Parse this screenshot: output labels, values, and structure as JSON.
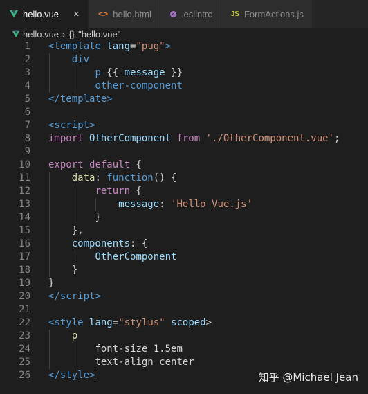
{
  "tabs": [
    {
      "label": "hello.vue",
      "icon": "vue-icon",
      "active": true,
      "close": "×"
    },
    {
      "label": "hello.html",
      "icon": "html-icon",
      "active": false
    },
    {
      "label": ".eslintrc",
      "icon": "eslintrc-icon",
      "active": false
    },
    {
      "label": "FormActions.js",
      "icon": "js-icon",
      "active": false
    }
  ],
  "icons": {
    "html": "<>",
    "js": "JS"
  },
  "breadcrumb": {
    "file": "hello.vue",
    "separator": "›",
    "symbol_icon": "{}",
    "symbol": "\"hello.vue\""
  },
  "colors": {
    "tag": "#569cd6",
    "attr": "#9cdcfe",
    "string": "#ce9178",
    "keyword": "#c586c0",
    "plain": "#d4d4d4",
    "pug": "#4ec9b0",
    "function": "#dcdcaa",
    "property": "#9cdcfe",
    "storage": "#569cd6",
    "stylus_prop": "#9cdcfe"
  },
  "lines": [
    {
      "n": "1",
      "indent": 0,
      "tokens": [
        [
          "<",
          "tag"
        ],
        [
          "template",
          "tag"
        ],
        [
          " lang",
          "attr"
        ],
        [
          "=",
          "plain"
        ],
        [
          "\"pug\"",
          "string"
        ],
        [
          ">",
          "tag"
        ]
      ]
    },
    {
      "n": "2",
      "indent": 1,
      "tokens": [
        [
          "div",
          "tag"
        ]
      ]
    },
    {
      "n": "3",
      "indent": 2,
      "tokens": [
        [
          "p",
          "tag"
        ],
        [
          " {{ ",
          "plain"
        ],
        [
          "message",
          "attr"
        ],
        [
          " }}",
          "plain"
        ]
      ]
    },
    {
      "n": "4",
      "indent": 2,
      "tokens": [
        [
          "other-component",
          "tag"
        ]
      ]
    },
    {
      "n": "5",
      "indent": 0,
      "tokens": [
        [
          "</",
          "tag"
        ],
        [
          "template",
          "tag"
        ],
        [
          ">",
          "tag"
        ]
      ]
    },
    {
      "n": "6",
      "indent": 0,
      "tokens": []
    },
    {
      "n": "7",
      "indent": 0,
      "tokens": [
        [
          "<",
          "tag"
        ],
        [
          "script",
          "tag"
        ],
        [
          ">",
          "tag"
        ]
      ]
    },
    {
      "n": "8",
      "indent": 0,
      "tokens": [
        [
          "import",
          "keyword"
        ],
        [
          " OtherComponent ",
          "attr"
        ],
        [
          "from",
          "keyword"
        ],
        [
          " ",
          "plain"
        ],
        [
          "'./OtherComponent.vue'",
          "string"
        ],
        [
          ";",
          "plain"
        ]
      ]
    },
    {
      "n": "9",
      "indent": 0,
      "tokens": []
    },
    {
      "n": "10",
      "indent": 0,
      "tokens": [
        [
          "export",
          "keyword"
        ],
        [
          " ",
          "plain"
        ],
        [
          "default",
          "keyword"
        ],
        [
          " {",
          "plain"
        ]
      ]
    },
    {
      "n": "11",
      "indent": 1,
      "tokens": [
        [
          "data",
          "function"
        ],
        [
          ": ",
          "plain"
        ],
        [
          "function",
          "storage"
        ],
        [
          "() {",
          "plain"
        ]
      ]
    },
    {
      "n": "12",
      "indent": 2,
      "tokens": [
        [
          "return",
          "keyword"
        ],
        [
          " {",
          "plain"
        ]
      ]
    },
    {
      "n": "13",
      "indent": 3,
      "tokens": [
        [
          "message",
          "property"
        ],
        [
          ": ",
          "plain"
        ],
        [
          "'Hello Vue.js'",
          "string"
        ]
      ]
    },
    {
      "n": "14",
      "indent": 2,
      "tokens": [
        [
          "}",
          "plain"
        ]
      ]
    },
    {
      "n": "15",
      "indent": 1,
      "tokens": [
        [
          "},",
          "plain"
        ]
      ]
    },
    {
      "n": "16",
      "indent": 1,
      "tokens": [
        [
          "components",
          "property"
        ],
        [
          ": {",
          "plain"
        ]
      ]
    },
    {
      "n": "17",
      "indent": 2,
      "tokens": [
        [
          "OtherComponent",
          "property"
        ]
      ]
    },
    {
      "n": "18",
      "indent": 1,
      "tokens": [
        [
          "}",
          "plain"
        ]
      ]
    },
    {
      "n": "19",
      "indent": 0,
      "tokens": [
        [
          "}",
          "plain"
        ]
      ]
    },
    {
      "n": "20",
      "indent": 0,
      "tokens": [
        [
          "</",
          "tag"
        ],
        [
          "script",
          "tag"
        ],
        [
          ">",
          "tag"
        ]
      ]
    },
    {
      "n": "21",
      "indent": 0,
      "tokens": []
    },
    {
      "n": "22",
      "indent": 0,
      "tokens": [
        [
          "<",
          "tag"
        ],
        [
          "style",
          "tag"
        ],
        [
          " lang",
          "attr"
        ],
        [
          "=",
          "plain"
        ],
        [
          "\"stylus\"",
          "string"
        ],
        [
          " scoped",
          "attr"
        ],
        [
          ">",
          "plain"
        ]
      ]
    },
    {
      "n": "23",
      "indent": 1,
      "tokens": [
        [
          "p",
          "function"
        ]
      ]
    },
    {
      "n": "24",
      "indent": 2,
      "tokens": [
        [
          "font-size",
          "plain"
        ],
        [
          " 1.5em",
          "plain"
        ]
      ]
    },
    {
      "n": "25",
      "indent": 2,
      "tokens": [
        [
          "text-align",
          "plain"
        ],
        [
          " center",
          "plain"
        ]
      ]
    },
    {
      "n": "26",
      "indent": 0,
      "tokens": [
        [
          "</",
          "tag"
        ],
        [
          "style",
          "tag"
        ],
        [
          ">",
          "tag"
        ]
      ],
      "cursor": true
    }
  ],
  "watermark": "知乎 @Michael Jean"
}
